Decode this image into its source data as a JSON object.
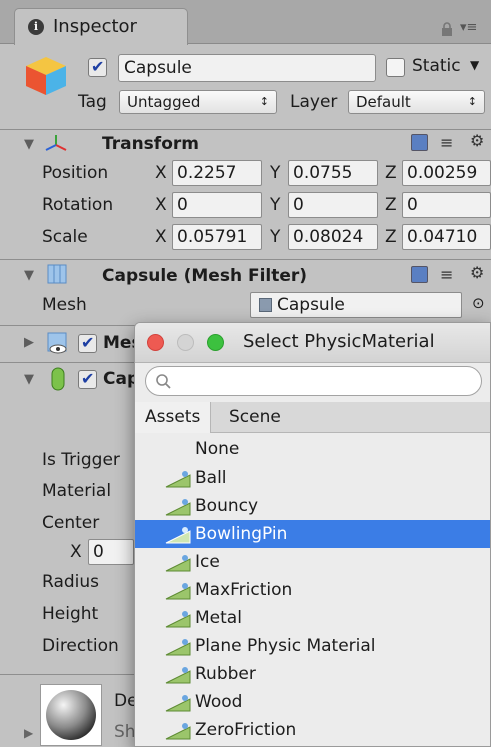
{
  "tab": {
    "title": "Inspector"
  },
  "header": {
    "object_name": "Capsule",
    "static_label": "Static",
    "tag_label": "Tag",
    "tag_value": "Untagged",
    "layer_label": "Layer",
    "layer_value": "Default"
  },
  "transform": {
    "title": "Transform",
    "position": {
      "label": "Position",
      "x": "0.2257",
      "y": "0.0755",
      "z": "0.00259"
    },
    "rotation": {
      "label": "Rotation",
      "x": "0",
      "y": "0",
      "z": "0"
    },
    "scale": {
      "label": "Scale",
      "x": "0.05791",
      "y": "0.08024",
      "z": "0.04710"
    },
    "axis": {
      "x": "X",
      "y": "Y",
      "z": "Z"
    }
  },
  "mesh_filter": {
    "title": "Capsule (Mesh Filter)",
    "mesh_label": "Mesh",
    "mesh_value": "Capsule"
  },
  "mesh_renderer": {
    "title_partial": "Mes"
  },
  "capsule_collider": {
    "title_partial": "Cap",
    "is_trigger_label": "Is Trigger",
    "material_label": "Material",
    "center_label": "Center",
    "center_x_label": "X",
    "center_x_value": "0",
    "radius_label": "Radius",
    "height_label": "Height",
    "direction_label": "Direction"
  },
  "material_preview": {
    "name_partial": "De",
    "shader_partial": "Sh"
  },
  "popup": {
    "title": "Select PhysicMaterial",
    "search_placeholder": "",
    "tabs": [
      "Assets",
      "Scene"
    ],
    "none_label": "None",
    "items": [
      "Ball",
      "Bouncy",
      "BowlingPin",
      "Ice",
      "MaxFriction",
      "Metal",
      "Plane Physic Material",
      "Rubber",
      "Wood",
      "ZeroFriction"
    ],
    "selected": "BowlingPin"
  },
  "colors": {
    "selection": "#3b7de6",
    "traffic_red": "#ee5a52",
    "traffic_green": "#3cc13f"
  }
}
